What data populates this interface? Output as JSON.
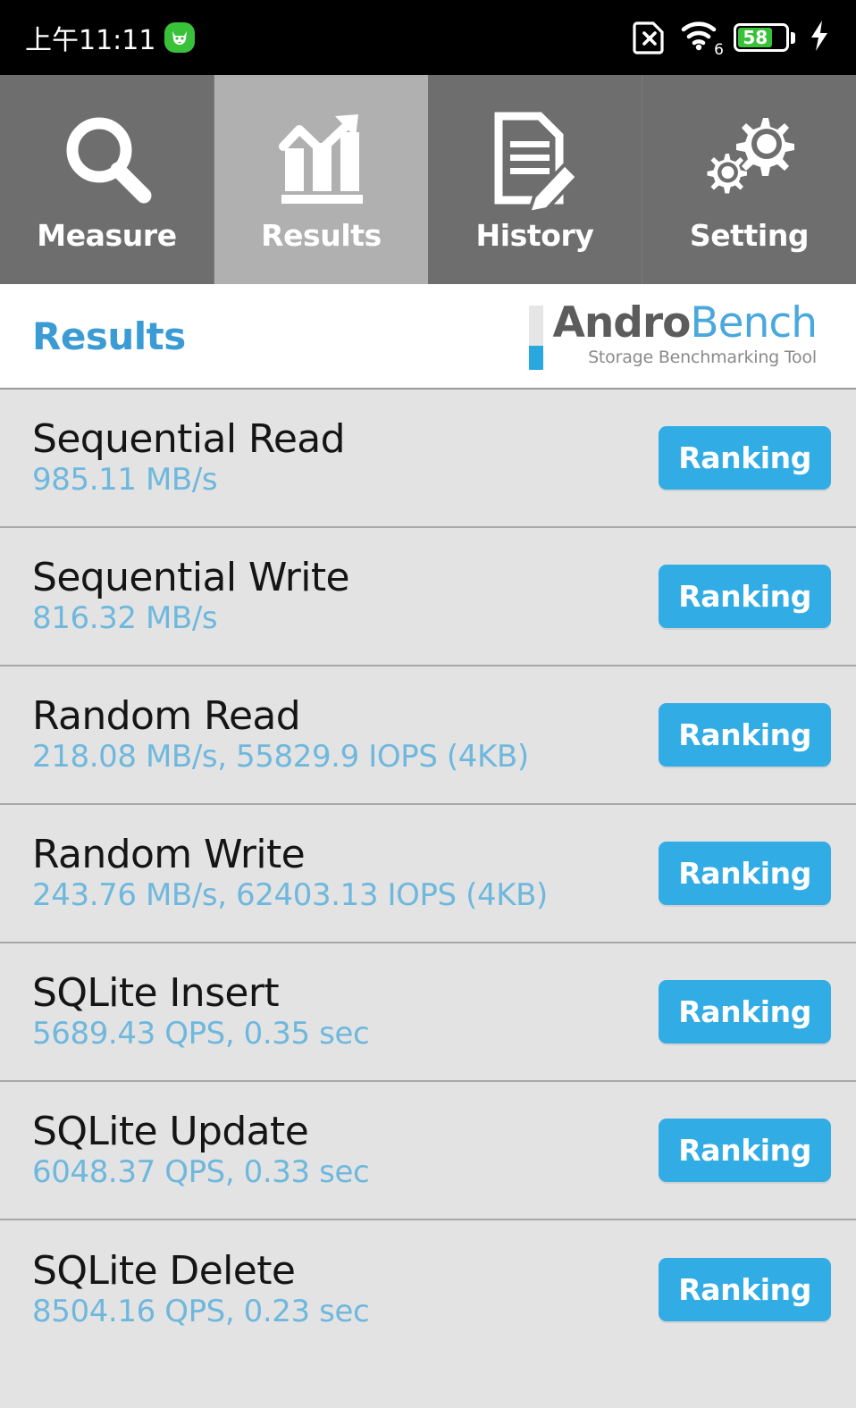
{
  "statusbar": {
    "time": "上午11:11",
    "badge_icon": "cat-face-icon",
    "sim_icon": "sim-card-disabled-icon",
    "wifi_icon": "wifi-6-icon",
    "wifi_generation": "6",
    "battery_level": "58",
    "battery_charging_icon": "lightning-bolt-icon",
    "battery_color": "#3ac13a"
  },
  "tabs": [
    {
      "label": "Measure",
      "icon": "magnifier-icon",
      "active": false
    },
    {
      "label": "Results",
      "icon": "bar-chart-trend-icon",
      "active": true
    },
    {
      "label": "History",
      "icon": "document-pencil-icon",
      "active": false
    },
    {
      "label": "Setting",
      "icon": "gears-icon",
      "active": false
    }
  ],
  "header": {
    "title": "Results",
    "title_color": "#3b9bd4",
    "logo": {
      "name_part1": "Andro",
      "name_part2": "Bench",
      "tagline": "Storage Benchmarking Tool",
      "part1_color": "#5c5c5c",
      "part2_color": "#4aa8dd",
      "accent_color": "#29a8e0"
    }
  },
  "list": {
    "button_label": "Ranking",
    "button_color": "#31ace4",
    "value_color": "#6fb8dd",
    "rows": [
      {
        "title": "Sequential Read",
        "value": "985.11 MB/s"
      },
      {
        "title": "Sequential Write",
        "value": "816.32 MB/s"
      },
      {
        "title": "Random Read",
        "value": "218.08 MB/s, 55829.9 IOPS (4KB)"
      },
      {
        "title": "Random Write",
        "value": "243.76 MB/s, 62403.13 IOPS (4KB)"
      },
      {
        "title": "SQLite Insert",
        "value": "5689.43 QPS, 0.35 sec"
      },
      {
        "title": "SQLite Update",
        "value": "6048.37 QPS, 0.33 sec"
      },
      {
        "title": "SQLite Delete",
        "value": "8504.16 QPS, 0.23 sec"
      }
    ]
  }
}
